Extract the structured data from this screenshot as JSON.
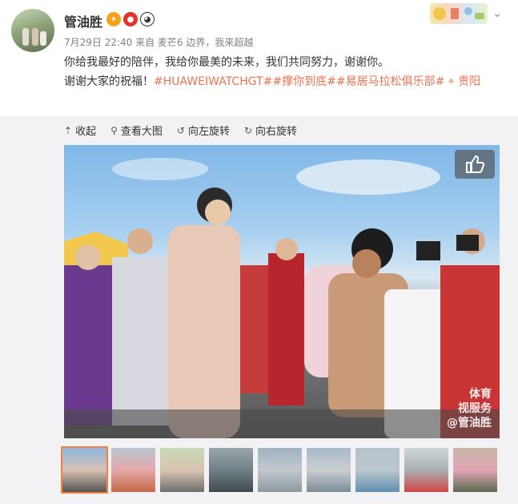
{
  "post": {
    "username": "管油胜",
    "badges": [
      "vip-badge",
      "red-badge",
      "panda-badge"
    ],
    "meta": "7月29日 22:40 来自 麦芒6 边界，我来超越",
    "text_line1": "你给我最好的陪伴，我给你最美的未来，我们共同努力，谢谢你。",
    "text_line2_prefix": "谢谢大家的祝福！",
    "tags": [
      "#HUAWEIWATCHGT#",
      "#撑你到底#",
      "#易居马拉松俱乐部#"
    ],
    "location": "贵阳"
  },
  "toolbar": {
    "collapse": "收起",
    "view_large": "查看大图",
    "rotate_left": "向左旋转",
    "rotate_right": "向右旋转"
  },
  "image": {
    "watermark_line1": "体育",
    "watermark_line2": "视服务",
    "watermark_line3": "@管油胜"
  },
  "thumbnails": [
    {
      "active": true
    },
    {
      "active": false
    },
    {
      "active": false
    },
    {
      "active": false
    },
    {
      "active": false
    },
    {
      "active": false
    },
    {
      "active": false
    },
    {
      "active": false
    },
    {
      "active": false
    }
  ],
  "colors": {
    "accent": "#eb7350",
    "meta_text": "#808080",
    "active_thumb_border": "#fa7d3c"
  }
}
